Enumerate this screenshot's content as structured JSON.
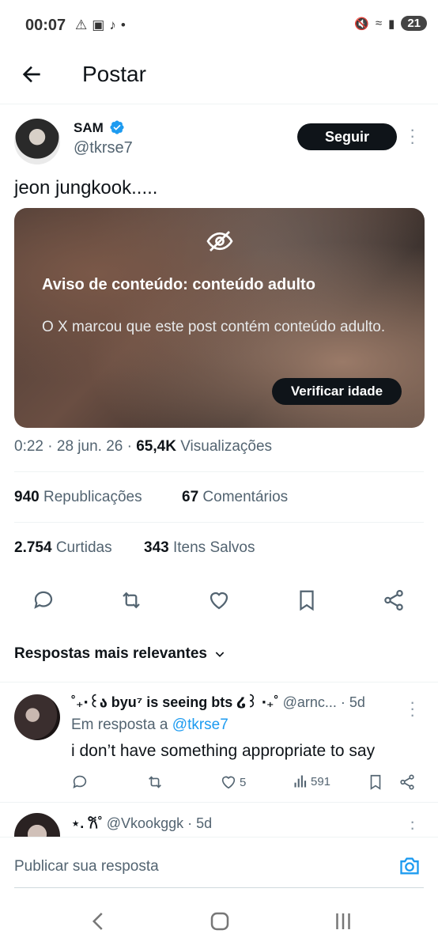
{
  "status_bar": {
    "time": "00:07",
    "left_icons": [
      "warning-icon",
      "instagram-icon",
      "tiktok-icon",
      "dot"
    ],
    "battery": "21"
  },
  "header": {
    "title": "Postar"
  },
  "post": {
    "author_name": "SAM",
    "author_handle": "@tkrse7",
    "follow_label": "Seguir",
    "text": "jeon jungkook.....",
    "media_warning": {
      "title": "Aviso de conteúdo: conteúdo adulto",
      "body": "O X marcou que este post contém conteúdo adulto.",
      "button": "Verificar idade"
    },
    "meta": {
      "time": "0:22",
      "date": "28 jun. 26",
      "views": "65,4K",
      "views_label": "Visualizações"
    },
    "stats": {
      "reposts": "940",
      "reposts_label": "Republicações",
      "comments": "67",
      "comments_label": "Comentários",
      "likes": "2.754",
      "likes_label": "Curtidas",
      "saves": "343",
      "saves_label": "Itens Salvos"
    }
  },
  "replies_sort_label": "Respostas mais relevantes",
  "replies": [
    {
      "name": "˚₊‧꒰ა byu⁷ is seeing bts ໒꒱ ‧₊˚",
      "handle": "@arnc...",
      "age": "· 5d",
      "reply_prefix": "Em resposta a",
      "reply_to": "@tkrse7",
      "text": "i don’t have something appropriate to say",
      "likes": "5",
      "views": "591"
    },
    {
      "name": "⋆. 𐙚˚",
      "handle": "@Vkookggk",
      "age": "· 5d"
    }
  ],
  "composer": {
    "placeholder": "Publicar sua resposta"
  },
  "colors": {
    "accent": "#1d9bf0",
    "text": "#0f1419",
    "muted": "#536471"
  }
}
